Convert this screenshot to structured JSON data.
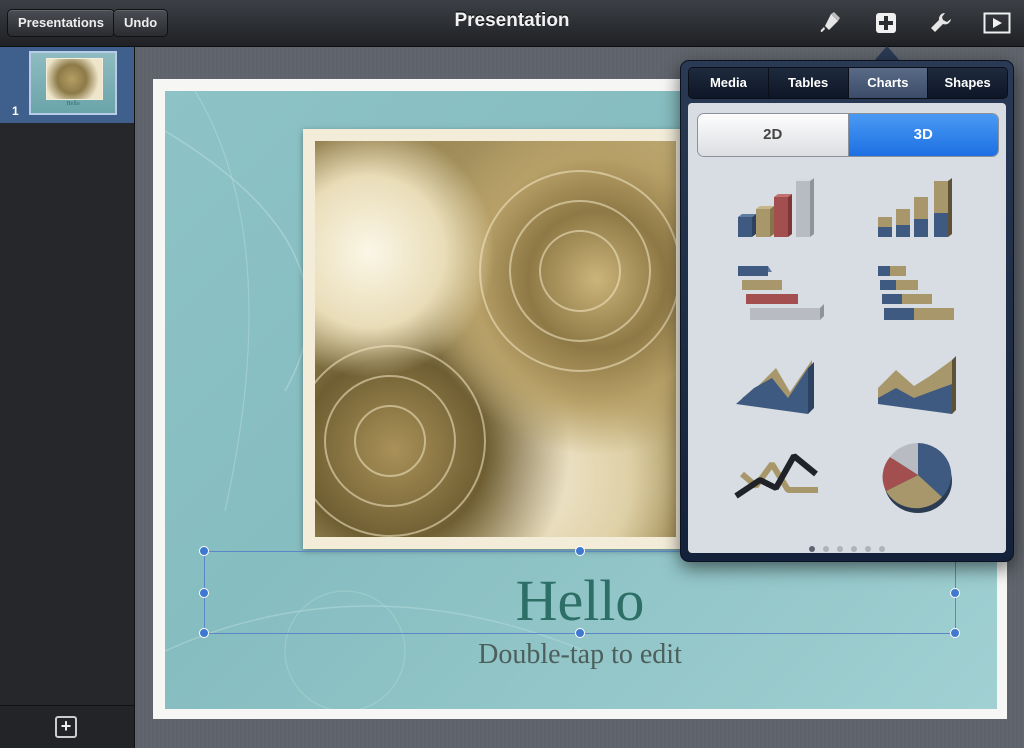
{
  "toolbar": {
    "presentations_label": "Presentations",
    "undo_label": "Undo",
    "title": "Presentation",
    "icons": [
      "paintbrush-icon",
      "add-icon",
      "wrench-icon",
      "play-icon"
    ]
  },
  "sidebar": {
    "slides": [
      {
        "number": "1",
        "thumb_title": "Hello"
      }
    ],
    "add_icon": "add-slide-icon"
  },
  "slide": {
    "title": "Hello",
    "subtitle": "Double-tap to edit"
  },
  "popover": {
    "tabs": [
      {
        "label": "Media",
        "active": false
      },
      {
        "label": "Tables",
        "active": false
      },
      {
        "label": "Charts",
        "active": true
      },
      {
        "label": "Shapes",
        "active": false
      }
    ],
    "segments": [
      {
        "label": "2D",
        "selected": false
      },
      {
        "label": "3D",
        "selected": true
      }
    ],
    "charts": [
      {
        "name": "3d-column-chart"
      },
      {
        "name": "3d-stacked-column-chart"
      },
      {
        "name": "3d-bar-chart"
      },
      {
        "name": "3d-stacked-bar-chart"
      },
      {
        "name": "3d-area-chart"
      },
      {
        "name": "3d-stacked-area-chart"
      },
      {
        "name": "3d-line-chart"
      },
      {
        "name": "3d-pie-chart"
      }
    ],
    "page_count": 6,
    "current_page": 1
  },
  "colors": {
    "accent_blue": "#1d6fe3",
    "slide_title": "#2d6e66",
    "chart_blue": "#3f5a80",
    "chart_tan": "#a8976a",
    "chart_red": "#a34f4f",
    "chart_gray": "#b8bcc2"
  }
}
